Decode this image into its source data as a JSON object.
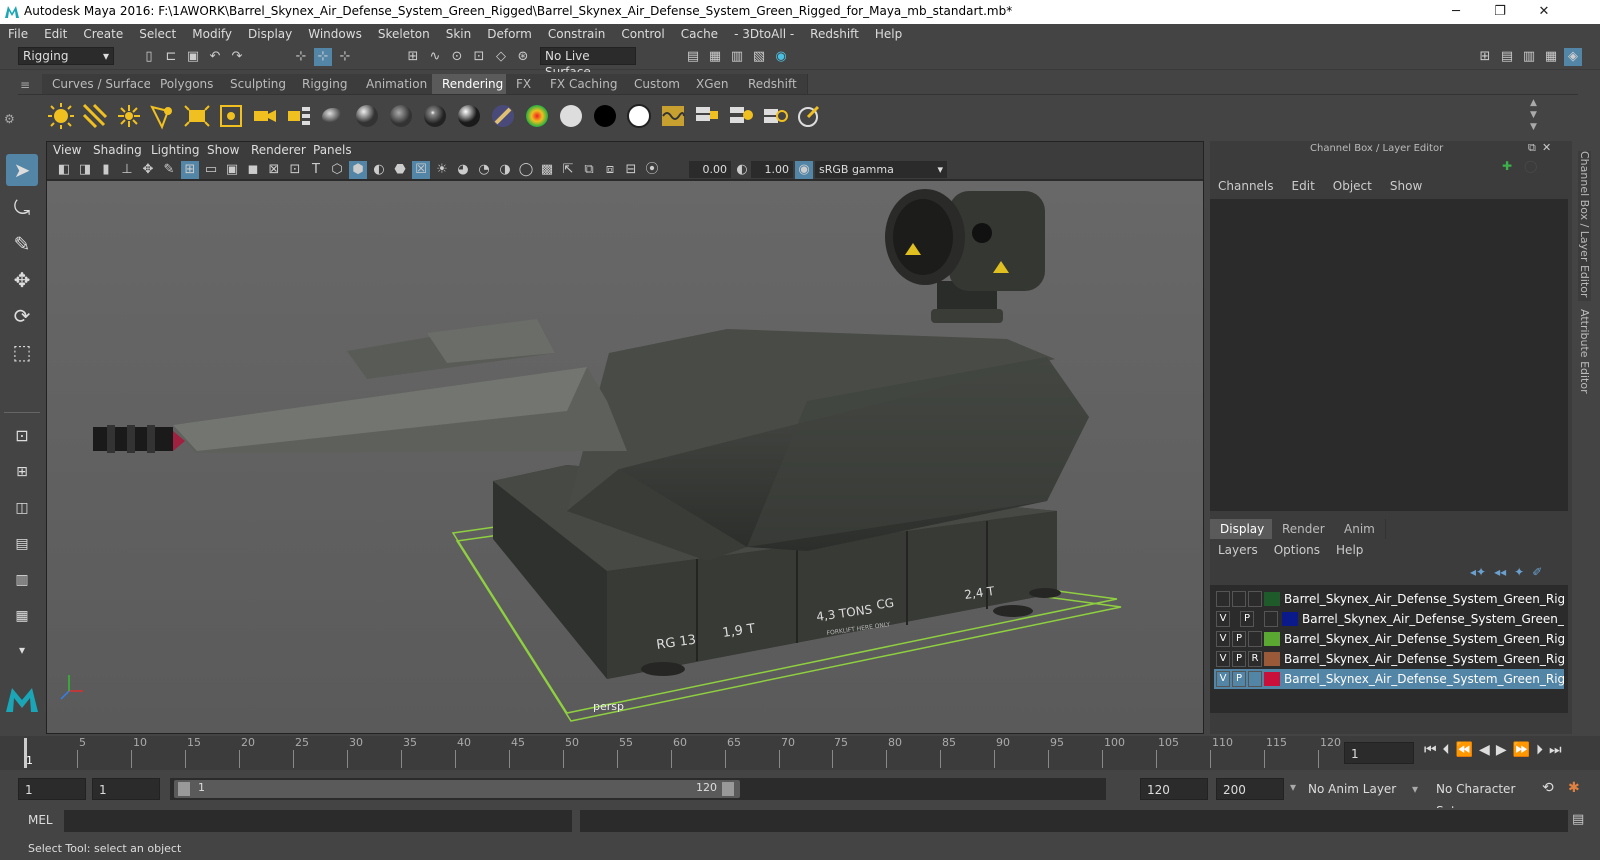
{
  "window": {
    "title": "Autodesk Maya 2016: F:\\1AWORK\\Barrel_Skynex_Air_Defense_System_Green_Rigged\\Barrel_Skynex_Air_Defense_System_Green_Rigged_for_Maya_mb_standart.mb*",
    "minimize": "─",
    "restore": "❐",
    "close": "✕"
  },
  "menubar": [
    "File",
    "Edit",
    "Create",
    "Select",
    "Modify",
    "Display",
    "Windows",
    "Skeleton",
    "Skin",
    "Deform",
    "Constrain",
    "Control",
    "Cache",
    "- 3DtoAll -",
    "Redshift",
    "Help"
  ],
  "toolbar": {
    "mode": "Rigging",
    "live_surface": "No Live Surface"
  },
  "shelf_tabs": [
    "Curves / Surfaces",
    "Polygons",
    "Sculpting",
    "Rigging",
    "Animation",
    "Rendering",
    "FX",
    "FX Caching",
    "Custom",
    "XGen",
    "Redshift"
  ],
  "shelf_active": "Rendering",
  "viewport": {
    "menus": [
      "View",
      "Shading",
      "Lighting",
      "Show",
      "Renderer",
      "Panels"
    ],
    "exposure": "0.00",
    "gamma": "1.00",
    "color_space": "sRGB gamma",
    "camera_label": "persp",
    "decals": {
      "rg": "RG 13",
      "w1": "1,9 T",
      "w2": "4,3 TONS",
      "cg": "CG",
      "w3": "2,4 T",
      "small": "FORKLIFT HERE ONLY"
    }
  },
  "channel_box": {
    "title": "Channel Box / Layer Editor",
    "menus": [
      "Channels",
      "Edit",
      "Object",
      "Show"
    ],
    "tabs": [
      "Display",
      "Render",
      "Anim"
    ],
    "active_tab": "Display",
    "layer_menus": [
      "Layers",
      "Options",
      "Help"
    ],
    "layers": [
      {
        "v": "",
        "p": "",
        "r": "",
        "color": "#1f5b2a",
        "name": "Barrel_Skynex_Air_Defense_System_Green_Rigged_helpei",
        "selected": false
      },
      {
        "v": "V",
        "p": "P",
        "r": "",
        "color": "#0a1a8a",
        "name": "Barrel_Skynex_Air_Defense_System_Green_Rigged",
        "selected": false
      },
      {
        "v": "V",
        "p": "P",
        "r": "",
        "color": "#5aa832",
        "name": "Barrel_Skynex_Air_Defense_System_Green_Rigged_contro",
        "selected": false
      },
      {
        "v": "V",
        "p": "P",
        "r": "R",
        "color": "#9a5a3a",
        "name": "Barrel_Skynex_Air_Defense_System_Green_Rigged_contro",
        "selected": false
      },
      {
        "v": "V",
        "p": "P",
        "r": "",
        "color": "#c8103a",
        "name": "Barrel_Skynex_Air_Defense_System_Green_Rigged_bones",
        "selected": true
      }
    ],
    "side_tabs": [
      "Channel Box / Layer Editor",
      "Attribute Editor"
    ]
  },
  "timeline": {
    "ticks": [
      "5",
      "10",
      "15",
      "20",
      "25",
      "30",
      "35",
      "40",
      "45",
      "50",
      "55",
      "60",
      "65",
      "70",
      "75",
      "80",
      "85",
      "90",
      "95",
      "100",
      "105",
      "110",
      "115",
      "120"
    ],
    "start_label": "1",
    "current_frame": "1"
  },
  "range": {
    "start": "1",
    "anim_start": "1",
    "slider_start": "1",
    "slider_end": "120",
    "end": "120",
    "anim_end": "200",
    "anim_layer": "No Anim Layer",
    "char_set": "No Character Set"
  },
  "cmd": {
    "label": "MEL"
  },
  "help_line": "Select Tool: select an object"
}
